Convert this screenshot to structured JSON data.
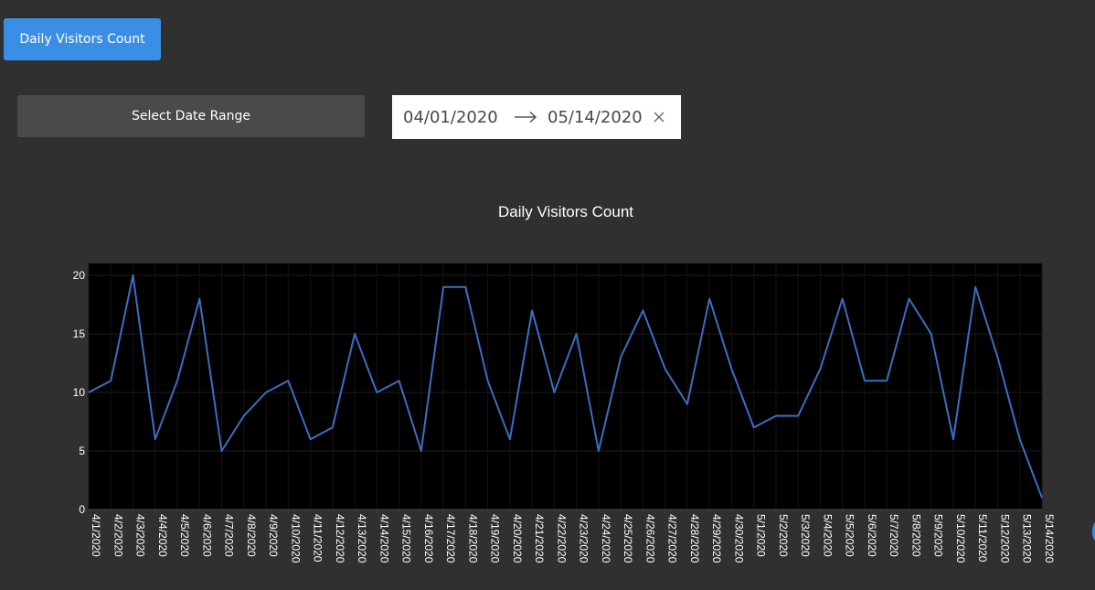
{
  "header": {
    "title_button_label": "Daily Visitors Count",
    "date_range_button_label": "Select Date Range"
  },
  "date_picker": {
    "start": "04/01/2020",
    "end": "05/14/2020"
  },
  "colors": {
    "accent": "#3a8ee6",
    "line": "#3b6fc1",
    "plot_bg": "#000000",
    "page_bg": "#303030"
  },
  "icons": {
    "arrow": "arrow-right-icon",
    "clear": "close-icon"
  },
  "chart_data": {
    "type": "line",
    "title": "Daily Visitors Count",
    "xlabel": "",
    "ylabel": "",
    "ylim": [
      0,
      21
    ],
    "yticks": [
      0,
      5,
      10,
      15,
      20
    ],
    "grid": true,
    "legend": "none",
    "categories": [
      "4/1/2020",
      "4/2/2020",
      "4/3/2020",
      "4/4/2020",
      "4/5/2020",
      "4/6/2020",
      "4/7/2020",
      "4/8/2020",
      "4/9/2020",
      "4/10/2020",
      "4/11/2020",
      "4/12/2020",
      "4/13/2020",
      "4/14/2020",
      "4/15/2020",
      "4/16/2020",
      "4/17/2020",
      "4/18/2020",
      "4/19/2020",
      "4/20/2020",
      "4/21/2020",
      "4/22/2020",
      "4/23/2020",
      "4/24/2020",
      "4/25/2020",
      "4/26/2020",
      "4/27/2020",
      "4/28/2020",
      "4/29/2020",
      "4/30/2020",
      "5/1/2020",
      "5/2/2020",
      "5/3/2020",
      "5/4/2020",
      "5/5/2020",
      "5/6/2020",
      "5/7/2020",
      "5/8/2020",
      "5/9/2020",
      "5/10/2020",
      "5/11/2020",
      "5/12/2020",
      "5/13/2020",
      "5/14/2020"
    ],
    "values": [
      10,
      11,
      20,
      6,
      11,
      18,
      5,
      8,
      10,
      11,
      6,
      7,
      15,
      10,
      11,
      5,
      19,
      19,
      11,
      6,
      17,
      10,
      15,
      5,
      13,
      17,
      12,
      9,
      18,
      12,
      7,
      8,
      8,
      12,
      18,
      11,
      11,
      18,
      15,
      6,
      19,
      13,
      6,
      1
    ]
  }
}
